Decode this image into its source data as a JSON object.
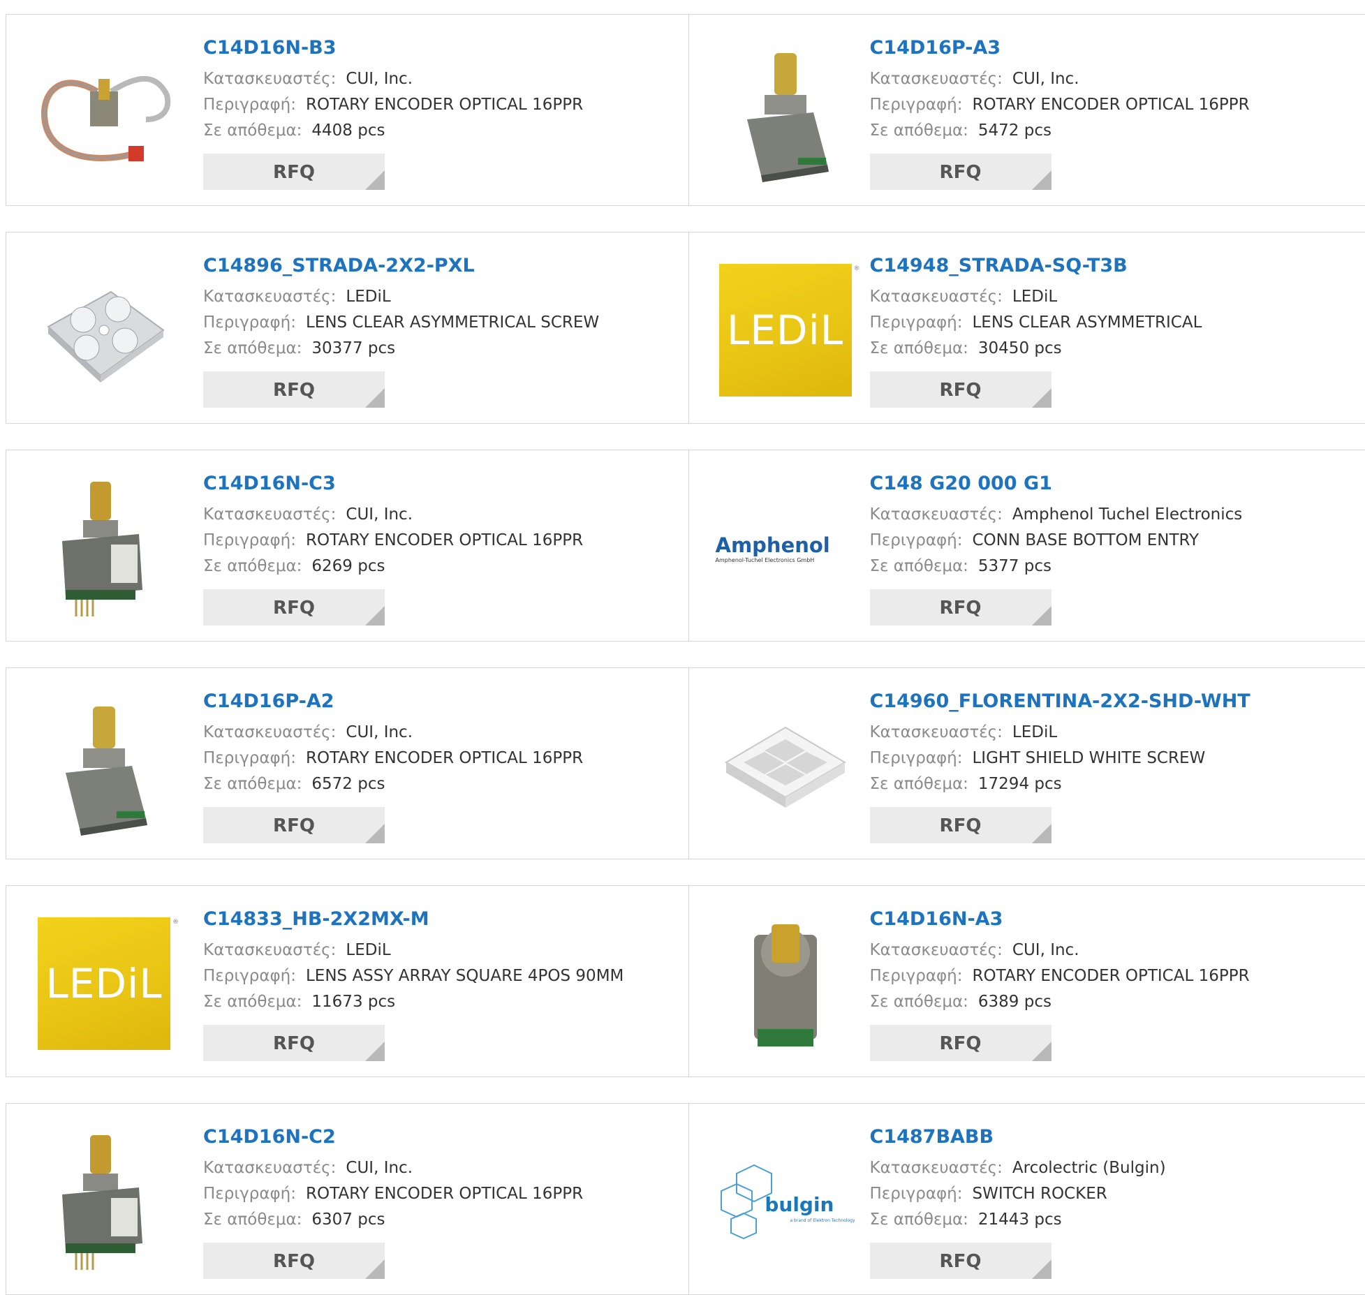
{
  "labels": {
    "manufacturer": "Κατασκευαστές:",
    "description": "Περιγραφή:",
    "stock": "Σε απόθεμα:"
  },
  "rfq_label": "RFQ",
  "products": [
    {
      "part": "C14D16N-B3",
      "manufacturer": "CUI, Inc.",
      "description": "ROTARY ENCODER OPTICAL 16PPR",
      "stock": "4408 pcs",
      "image": "encoder-cable-icon"
    },
    {
      "part": "C14D16P-A3",
      "manufacturer": "CUI, Inc.",
      "description": "ROTARY ENCODER OPTICAL 16PPR",
      "stock": "5472 pcs",
      "image": "encoder-icon"
    },
    {
      "part": "C14896_STRADA-2X2-PXL",
      "manufacturer": "LEDiL",
      "description": "LENS CLEAR ASYMMETRICAL SCREW",
      "stock": "30377 pcs",
      "image": "lens-icon"
    },
    {
      "part": "C14948_STRADA-SQ-T3B",
      "manufacturer": "LEDiL",
      "description": "LENS CLEAR ASYMMETRICAL",
      "stock": "30450 pcs",
      "image": "ledil-logo",
      "logo_text": "LEDiL"
    },
    {
      "part": "C14D16N-C3",
      "manufacturer": "CUI, Inc.",
      "description": "ROTARY ENCODER OPTICAL 16PPR",
      "stock": "6269 pcs",
      "image": "encoder-pins-icon"
    },
    {
      "part": "C148 G20 000 G1",
      "manufacturer": "Amphenol Tuchel Electronics",
      "description": "CONN BASE BOTTOM ENTRY",
      "stock": "5377 pcs",
      "image": "amphenol-logo",
      "logo_text": "Amphenol",
      "logo_sub": "Amphenol-Tuchel Electronics GmbH"
    },
    {
      "part": "C14D16P-A2",
      "manufacturer": "CUI, Inc.",
      "description": "ROTARY ENCODER OPTICAL 16PPR",
      "stock": "6572 pcs",
      "image": "encoder-icon"
    },
    {
      "part": "C14960_FLORENTINA-2X2-SHD-WHT",
      "manufacturer": "LEDiL",
      "description": "LIGHT SHIELD WHITE SCREW",
      "stock": "17294 pcs",
      "image": "shield-icon"
    },
    {
      "part": "C14833_HB-2X2MX-M",
      "manufacturer": "LEDiL",
      "description": "LENS ASSY ARRAY SQUARE 4POS 90MM",
      "stock": "11673 pcs",
      "image": "ledil-logo",
      "logo_text": "LEDiL"
    },
    {
      "part": "C14D16N-A3",
      "manufacturer": "CUI, Inc.",
      "description": "ROTARY ENCODER OPTICAL 16PPR",
      "stock": "6389 pcs",
      "image": "encoder-front-icon"
    },
    {
      "part": "C14D16N-C2",
      "manufacturer": "CUI, Inc.",
      "description": "ROTARY ENCODER OPTICAL 16PPR",
      "stock": "6307 pcs",
      "image": "encoder-pins-icon"
    },
    {
      "part": "C1487BABB",
      "manufacturer": "Arcolectric (Bulgin)",
      "description": "SWITCH ROCKER",
      "stock": "21443 pcs",
      "image": "bulgin-logo",
      "logo_text": "bulgin",
      "logo_sub": "a brand of Elektron Technology"
    }
  ]
}
